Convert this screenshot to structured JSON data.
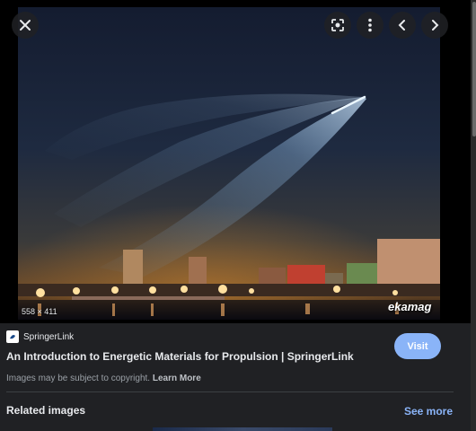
{
  "viewer": {
    "image_dimensions": "558 × 411",
    "watermark": "ekamag",
    "controls": {
      "close": "close-icon",
      "lens": "lens-icon",
      "more": "more-vert-icon",
      "prev": "chevron-left-icon",
      "next": "chevron-right-icon"
    }
  },
  "source": {
    "name": "SpringerLink",
    "page_title": "An Introduction to Energetic Materials for Propulsion | SpringerLink",
    "visit_label": "Visit"
  },
  "copyright": {
    "text": "Images may be subject to copyright. ",
    "learn_more": "Learn More"
  },
  "related": {
    "title": "Related images",
    "see_more": "See more"
  },
  "colors": {
    "panel_bg": "#202124",
    "accent": "#8ab4f8",
    "text": "#e8eaed",
    "muted": "#9aa0a6"
  }
}
